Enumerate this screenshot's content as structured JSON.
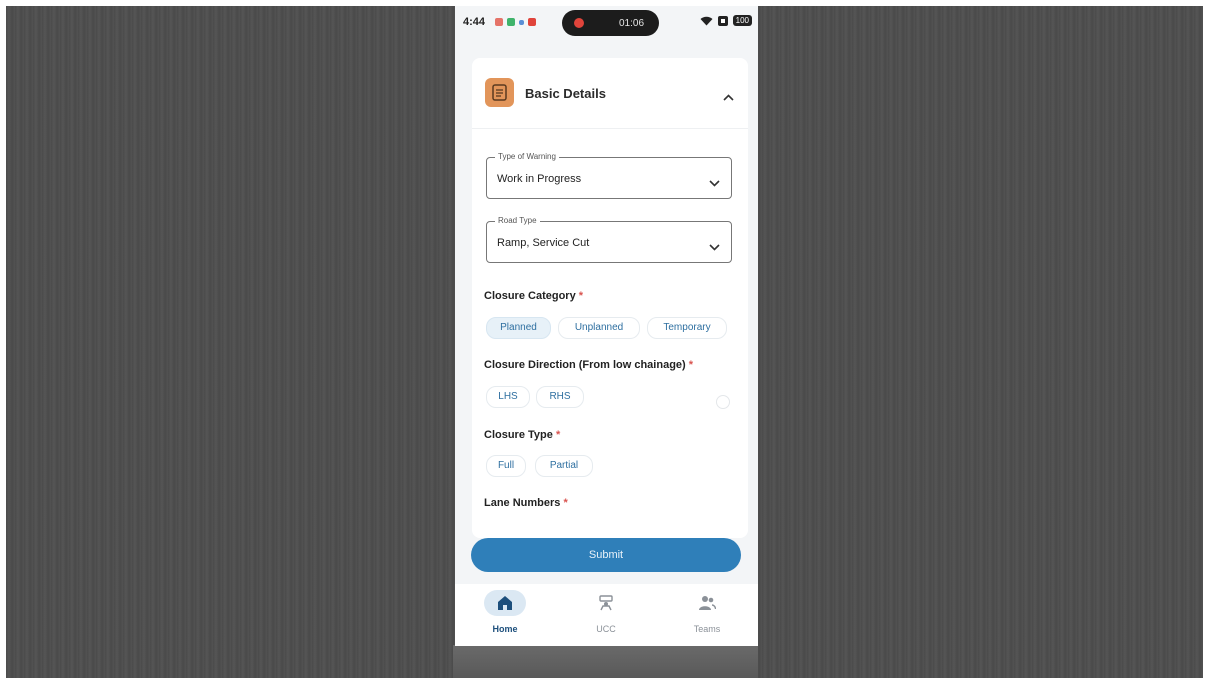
{
  "status_bar": {
    "time": "4:44",
    "recording_time": "01:06",
    "battery": "100"
  },
  "form": {
    "section_title": "Basic Details",
    "type_of_warning": {
      "label": "Type of Warning",
      "value": "Work in Progress"
    },
    "road_type": {
      "label": "Road Type",
      "value": "Ramp, Service Cut"
    },
    "closure_category": {
      "label": "Closure Category",
      "required_mark": "*",
      "options": [
        "Planned",
        "Unplanned",
        "Temporary"
      ],
      "selected": "Planned"
    },
    "closure_direction": {
      "label": "Closure Direction (From low chainage)",
      "required_mark": "*",
      "options": [
        "LHS",
        "RHS"
      ]
    },
    "closure_type": {
      "label": "Closure Type",
      "required_mark": "*",
      "options": [
        "Full",
        "Partial"
      ]
    },
    "lane_numbers": {
      "label": "Lane Numbers",
      "required_mark": "*"
    }
  },
  "submit_label": "Submit",
  "bottom_nav": {
    "items": [
      {
        "label": "Home",
        "icon": "home-icon",
        "active": true
      },
      {
        "label": "UCC",
        "icon": "control-room-icon",
        "active": false
      },
      {
        "label": "Teams",
        "icon": "team-icon",
        "active": false
      }
    ]
  },
  "colors": {
    "accent": "#2f7fb9",
    "header_icon": "#e2955a",
    "required": "#d9534f"
  }
}
